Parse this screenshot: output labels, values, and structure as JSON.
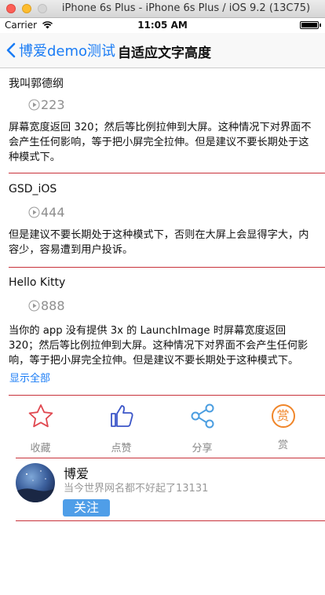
{
  "window": {
    "title": "iPhone 6s Plus - iPhone 6s Plus / iOS 9.2 (13C75)"
  },
  "status_bar": {
    "carrier": "Carrier",
    "time": "11:05 AM"
  },
  "nav": {
    "back_label": "博爱demo测试",
    "title": "自适应文字高度"
  },
  "posts": [
    {
      "name": "我叫郭德纲",
      "plays": "223",
      "text": "屏幕宽度返回 320；然后等比例拉伸到大屏。这种情况下对界面不会产生任何影响，等于把小屏完全拉伸。但是建议不要长期处于这种模式下。"
    },
    {
      "name": "GSD_iOS",
      "plays": "444",
      "text": "但是建议不要长期处于这种模式下，否则在大屏上会显得字大，内容少，容易遭到用户投诉。"
    },
    {
      "name": "Hello Kitty",
      "plays": "888",
      "text": "当你的 app 没有提供 3x 的 LaunchImage 时屏幕宽度返回 320；然后等比例拉伸到大屏。这种情况下对界面不会产生任何影响，等于把小屏完全拉伸。但是建议不要长期处于这种模式下。",
      "show_all": "显示全部"
    }
  ],
  "actions": {
    "collect": "收藏",
    "like": "点赞",
    "share": "分享",
    "reward": "赏",
    "reward_label": "赏"
  },
  "profile": {
    "name": "博爱",
    "subtitle": "当今世界网名都不好起了13131",
    "follow_label": "关注"
  },
  "colors": {
    "accent": "#1a7cf5",
    "separator": "#c8323a",
    "star": "#e04850",
    "like": "#3b55c8",
    "share": "#4a9de0",
    "reward": "#f0862a",
    "follow_bg": "#4f9ee8"
  }
}
